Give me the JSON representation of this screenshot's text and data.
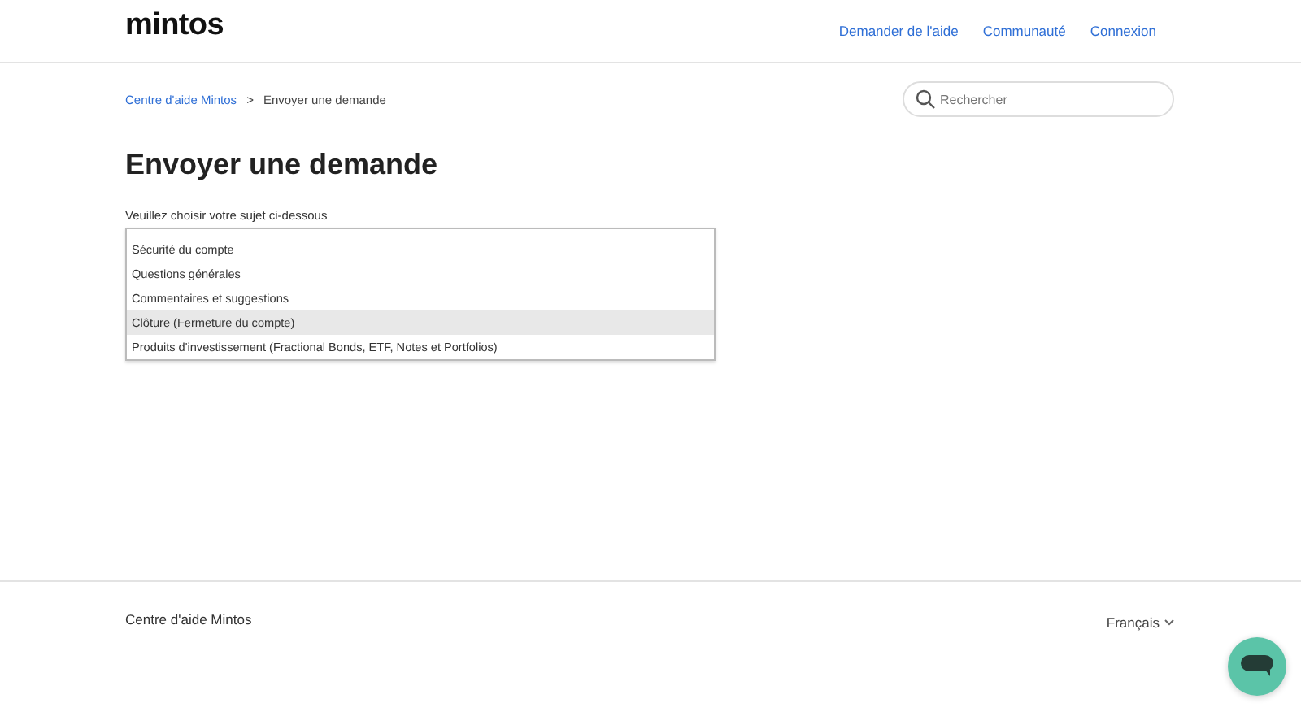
{
  "header": {
    "logo": "mintos",
    "nav": [
      "Demander de l'aide",
      "Communauté",
      "Connexion"
    ]
  },
  "breadcrumb": {
    "items": [
      "Centre d'aide Mintos",
      "Envoyer une demande"
    ],
    "separator": ">"
  },
  "search": {
    "placeholder": "Rechercher"
  },
  "title": "Envoyer une demande",
  "subject": {
    "label": "Veuillez choisir votre sujet ci-dessous",
    "options": [
      {
        "label": "Sécurité du compte",
        "selected": false
      },
      {
        "label": "Questions générales",
        "selected": false
      },
      {
        "label": "Commentaires et suggestions",
        "selected": false
      },
      {
        "label": "Clôture (Fermeture du compte)",
        "selected": true
      },
      {
        "label": "Produits d'investissement (Fractional Bonds, ETF, Notes et Portfolios)",
        "selected": false
      }
    ]
  },
  "footer": {
    "text": "Centre d'aide Mintos",
    "language": "Français"
  }
}
